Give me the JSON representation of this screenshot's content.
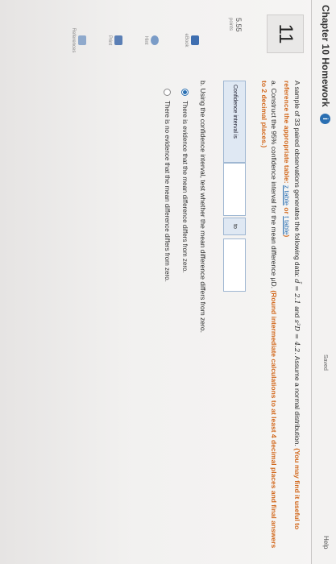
{
  "header": {
    "chapter_title": "Chapter 10 Homework",
    "info_icon": "info-icon",
    "saved_status": "Saved",
    "help_label": "Help"
  },
  "question": {
    "number": "11",
    "points": "5.55",
    "points_label": "points"
  },
  "sidebar": {
    "items": [
      {
        "label": "eBook",
        "icon": "book-icon"
      },
      {
        "label": "Hint",
        "icon": "hint-icon"
      },
      {
        "label": "Print",
        "icon": "print-icon"
      },
      {
        "label": "References",
        "icon": "references-icon"
      }
    ]
  },
  "problem": {
    "intro_start": "A sample of 33 paired observations generates the following data:",
    "dbar_expr": "d̄ = 2.1",
    "and": "and",
    "s2_expr": "s²D = 4.2.",
    "assume_normal": "Assume a normal distribution.",
    "hint_bold": "(You may find it useful to reference the appropriate table:",
    "ztable": "z table",
    "or": "or",
    "ttable": "t table",
    "hint_close": ")"
  },
  "part_a": {
    "text": "a. Construct the 95% confidence interval for the mean difference μD.",
    "rounding": "(Round intermediate calculations to at least 4 decimal places and final answers to 2 decimal places.)",
    "ci_label": "Confidence interval is",
    "lower_value": "",
    "to_label": "to",
    "upper_value": ""
  },
  "part_b": {
    "text": "b. Using the confidence interval, test whether the mean difference differs from zero.",
    "options": [
      {
        "label": "There is evidence that the mean difference differs from zero.",
        "selected": true
      },
      {
        "label": "There is no evidence that the mean difference differs from zero.",
        "selected": false
      }
    ]
  },
  "colors": {
    "accent": "#2a6fb2",
    "instruction": "#d2691e"
  }
}
